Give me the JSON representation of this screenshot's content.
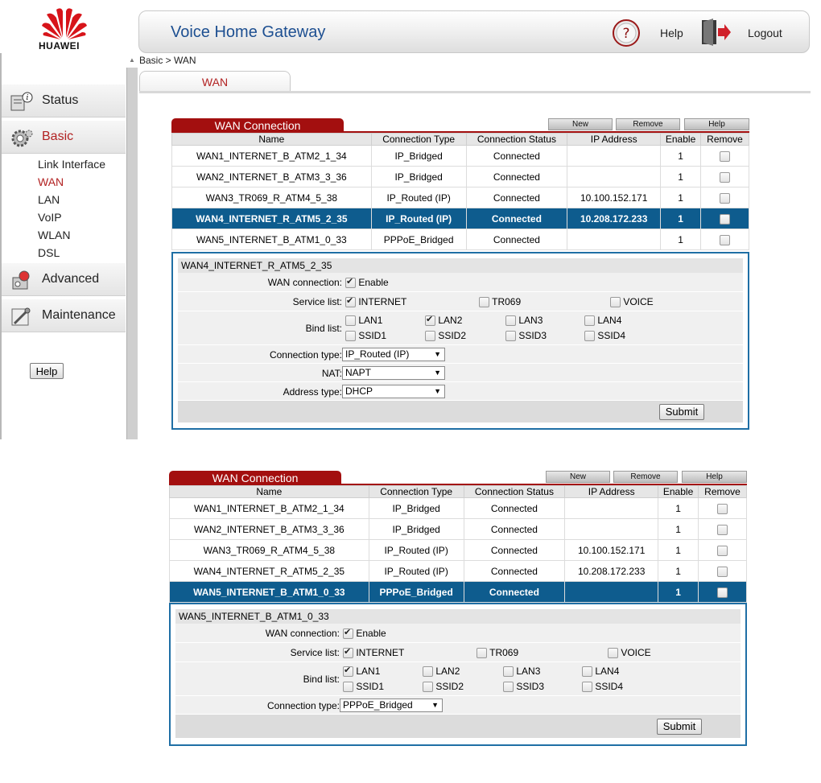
{
  "header": {
    "brand": "HUAWEI",
    "title": "Voice Home Gateway",
    "help_label": "Help",
    "logout_label": "Logout"
  },
  "breadcrumb": "Basic > WAN",
  "tab_label": "WAN",
  "sidebar": {
    "menus": [
      {
        "label": "Status",
        "icon": "status-icon"
      },
      {
        "label": "Basic",
        "icon": "gear-icon"
      },
      {
        "label": "Advanced",
        "icon": "advanced-icon"
      },
      {
        "label": "Maintenance",
        "icon": "tools-icon"
      }
    ],
    "basic_items": [
      "Link Interface",
      "WAN",
      "LAN",
      "VoIP",
      "WLAN",
      "DSL"
    ],
    "help_button": "Help"
  },
  "wan_section": {
    "title": "WAN Connection",
    "buttons": {
      "new": "New",
      "remove": "Remove",
      "help": "Help"
    },
    "columns": [
      "Name",
      "Connection Type",
      "Connection Status",
      "IP Address",
      "Enable",
      "Remove"
    ]
  },
  "table1": {
    "rows": [
      {
        "name": "WAN1_INTERNET_B_ATM2_1_34",
        "type": "IP_Bridged",
        "status": "Connected",
        "ip": "",
        "enable": "1"
      },
      {
        "name": "WAN2_INTERNET_B_ATM3_3_36",
        "type": "IP_Bridged",
        "status": "Connected",
        "ip": "",
        "enable": "1"
      },
      {
        "name": "WAN3_TR069_R_ATM4_5_38",
        "type": "IP_Routed (IP)",
        "status": "Connected",
        "ip": "10.100.152.171",
        "enable": "1"
      },
      {
        "name": "WAN4_INTERNET_R_ATM5_2_35",
        "type": "IP_Routed (IP)",
        "status": "Connected",
        "ip": "10.208.172.233",
        "enable": "1"
      },
      {
        "name": "WAN5_INTERNET_B_ATM1_0_33",
        "type": "PPPoE_Bridged",
        "status": "Connected",
        "ip": "",
        "enable": "1"
      }
    ],
    "detail": {
      "title": "WAN4_INTERNET_R_ATM5_2_35",
      "wan_connection_label": "WAN connection:",
      "enable_label": "Enable",
      "service_list_label": "Service list:",
      "services": [
        "INTERNET",
        "TR069",
        "VOICE"
      ],
      "bind_list_label": "Bind list:",
      "bind_lan": [
        "LAN1",
        "LAN2",
        "LAN3",
        "LAN4"
      ],
      "bind_ssid": [
        "SSID1",
        "SSID2",
        "SSID3",
        "SSID4"
      ],
      "connection_type_label": "Connection type:",
      "connection_type_value": "IP_Routed (IP)",
      "nat_label": "NAT:",
      "nat_value": "NAPT",
      "address_type_label": "Address type:",
      "address_type_value": "DHCP",
      "submit": "Submit"
    }
  },
  "table2": {
    "rows": [
      {
        "name": "WAN1_INTERNET_B_ATM2_1_34",
        "type": "IP_Bridged",
        "status": "Connected",
        "ip": "",
        "enable": "1"
      },
      {
        "name": "WAN2_INTERNET_B_ATM3_3_36",
        "type": "IP_Bridged",
        "status": "Connected",
        "ip": "",
        "enable": "1"
      },
      {
        "name": "WAN3_TR069_R_ATM4_5_38",
        "type": "IP_Routed (IP)",
        "status": "Connected",
        "ip": "10.100.152.171",
        "enable": "1"
      },
      {
        "name": "WAN4_INTERNET_R_ATM5_2_35",
        "type": "IP_Routed (IP)",
        "status": "Connected",
        "ip": "10.208.172.233",
        "enable": "1"
      },
      {
        "name": "WAN5_INTERNET_B_ATM1_0_33",
        "type": "PPPoE_Bridged",
        "status": "Connected",
        "ip": "",
        "enable": "1"
      }
    ],
    "detail": {
      "title": "WAN5_INTERNET_B_ATM1_0_33",
      "wan_connection_label": "WAN connection:",
      "enable_label": "Enable",
      "service_list_label": "Service list:",
      "services": [
        "INTERNET",
        "TR069",
        "VOICE"
      ],
      "bind_list_label": "Bind list:",
      "bind_lan": [
        "LAN1",
        "LAN2",
        "LAN3",
        "LAN4"
      ],
      "bind_ssid": [
        "SSID1",
        "SSID2",
        "SSID3",
        "SSID4"
      ],
      "connection_type_label": "Connection type:",
      "connection_type_value": "PPPoE_Bridged",
      "submit": "Submit"
    }
  },
  "colors": {
    "brand_red": "#a30f0f",
    "selected_row": "#0e5c8e",
    "title_blue": "#1d4f91",
    "active_menu": "#b22222"
  }
}
